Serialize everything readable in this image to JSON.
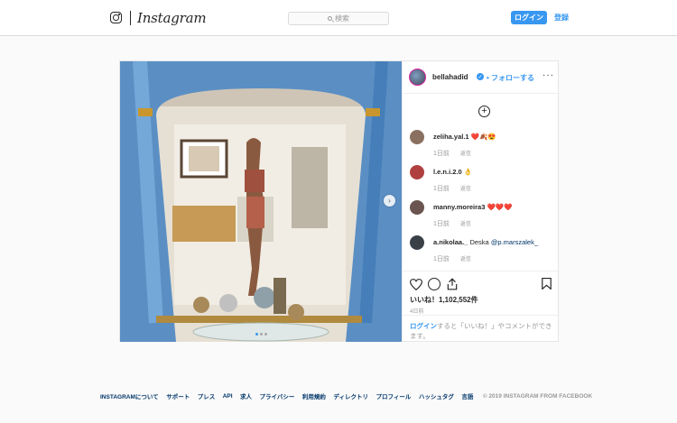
{
  "header": {
    "brand": "Instagram",
    "search_placeholder": "検索",
    "login_label": "ログイン",
    "signup_label": "登録"
  },
  "post": {
    "username": "bellahadid",
    "follow_label": "• フォローする",
    "more_label": "···",
    "comments": [
      {
        "user": "zeliha.yal.1",
        "text": "❤️🍂😍",
        "time": "1日前",
        "reply": "返信"
      },
      {
        "user": "l.e.n.i.2.0",
        "text": "👌",
        "time": "1日前",
        "reply": "返信"
      },
      {
        "user": "manny.moreira3",
        "text": "❤️❤️❤️",
        "time": "1日前",
        "reply": "返信"
      },
      {
        "user": "a.nikolaa._",
        "text": "Deska",
        "mention": "@p.marszalek_",
        "time": "1日前",
        "reply": "返信"
      }
    ],
    "likes": "いいね！1,102,552件",
    "date": "4日前",
    "login_link": "ログイン",
    "login_prompt": "すると「いいね！」やコメントができます。",
    "slide_count": 3,
    "active_slide": 1
  },
  "footer": {
    "links": [
      "INSTAGRAMについて",
      "サポート",
      "プレス",
      "API",
      "求人",
      "プライバシー",
      "利用規約",
      "ディレクトリ",
      "プロフィール",
      "ハッシュタグ",
      "言語"
    ],
    "copyright": "© 2019 INSTAGRAM FROM FACEBOOK"
  },
  "colors": {
    "accent": "#3897f0",
    "mirror_frame": "#4a8fd0",
    "heart": "#ed4956"
  }
}
